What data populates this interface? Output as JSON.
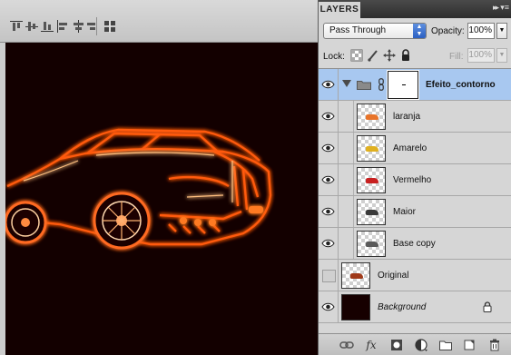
{
  "options_bar": {
    "align_buttons": [
      "align-top-edges-icon",
      "align-vertical-centers-icon",
      "align-bottom-edges-icon",
      "align-left-edges-icon",
      "align-horizontal-centers-icon",
      "align-right-edges-icon",
      "auto-align-layers-icon"
    ]
  },
  "layers_panel": {
    "tab_label": "LAYERS",
    "collapse_glyph": "▸▸",
    "menu_glyph": "▾≡",
    "blend_mode": "Pass Through",
    "opacity_label": "Opacity:",
    "opacity_value": "100%",
    "lock_label": "Lock:",
    "fill_label": "Fill:",
    "fill_value": "100%",
    "layers": [
      {
        "name": "Efeito_contorno",
        "type": "group",
        "visible": true,
        "selected": true
      },
      {
        "name": "laranja",
        "type": "layer",
        "visible": true,
        "tint": "#e8742a"
      },
      {
        "name": "Amarelo",
        "type": "layer",
        "visible": true,
        "tint": "#e0b020"
      },
      {
        "name": "Vermelho",
        "type": "layer",
        "visible": true,
        "tint": "#c82020"
      },
      {
        "name": "Maior",
        "type": "layer",
        "visible": true,
        "tint": "#3a3a3a"
      },
      {
        "name": "Base copy",
        "type": "layer",
        "visible": true,
        "tint": "#5a5a5a"
      },
      {
        "name": "Original",
        "type": "layer",
        "visible": false,
        "tint": "#a03a1a"
      },
      {
        "name": "Background",
        "type": "background",
        "visible": true,
        "locked": true
      }
    ],
    "footer_icons": [
      "link-layers-icon",
      "fx-icon",
      "layer-mask-icon",
      "adjustment-layer-icon",
      "new-group-icon",
      "new-layer-icon",
      "trash-icon"
    ],
    "fx_glyph": "fx"
  },
  "colors": {
    "selection": "#a8c8f0",
    "canvas_bg": "#130000",
    "glow_outer": "#ff4a00",
    "glow_inner": "#ffd8a0"
  }
}
